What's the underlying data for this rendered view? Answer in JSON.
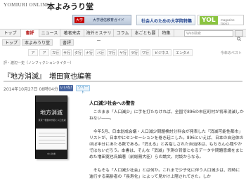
{
  "header": {
    "brand": "YOMIURI ONLINE",
    "site_title": "本よみうり堂",
    "banners": [
      {
        "tag": "大学",
        "text": "大学通信教育ガイド"
      },
      {
        "text": "社会人のための大学院特集"
      },
      {
        "logo": "YOL",
        "text": "magazine topics"
      }
    ]
  },
  "nav": {
    "items": [
      "トップ",
      "書評",
      "ニュース",
      "著者来店",
      "海外ミステリー",
      "コラム",
      "本ごとも要",
      "特集"
    ],
    "search_placeholder": "Web検索"
  },
  "breadcrumb": [
    "トップ",
    "本よみうり堂",
    "書評"
  ],
  "subnav": {
    "items": [
      "ア",
      "ア",
      "カ行",
      "サ行",
      "タ行",
      "ナ行",
      "ハ行",
      "マ行",
      "ヤ行",
      "ラ行",
      "ワ行",
      "ビジネス",
      "エンタメ"
    ],
    "label": "今年のベスト"
  },
  "article": {
    "author_line": "評・渡辺一史（ノンフィクションライター）",
    "title": "『地方消滅』　増田寛也編著",
    "date": "2014年10月27日 08時04分",
    "like_label": "いいね!",
    "tweet_label": "ツイート",
    "book": {
      "title": "地方消滅",
      "subtitle": "東京一極集中が招く人口急減",
      "publisher": "中公新書"
    },
    "section_heading": "人口減少社会への警告",
    "paragraphs": [
      "　このまま「人口減少」に手を打たなければ、全国で896の市区町村が将来消滅しかねない――。",
      "　今年5月、日本創成会議・人口減少問題検討分科会が発表した「消滅可能性都市」リストが、日本中にセンセーションを巻き起こした。896といえば、日本の自治体のほぼ半分にあたる数である。「消える」と名指しされた自治体は、もちろん心穏やかではないだろう。本書は、そんな「消滅」予測の背景となるデータや問題意識をまとめた増田寛也氏編著（前総務大臣）らの論文、対談からなる。",
      "　そもそも「人口減少社会」とは何か。これまで少子化に伴う人口減少は、同時に進行する高齢者の「長寿化」によって見かけ上隠されてきた。しか"
    ]
  }
}
